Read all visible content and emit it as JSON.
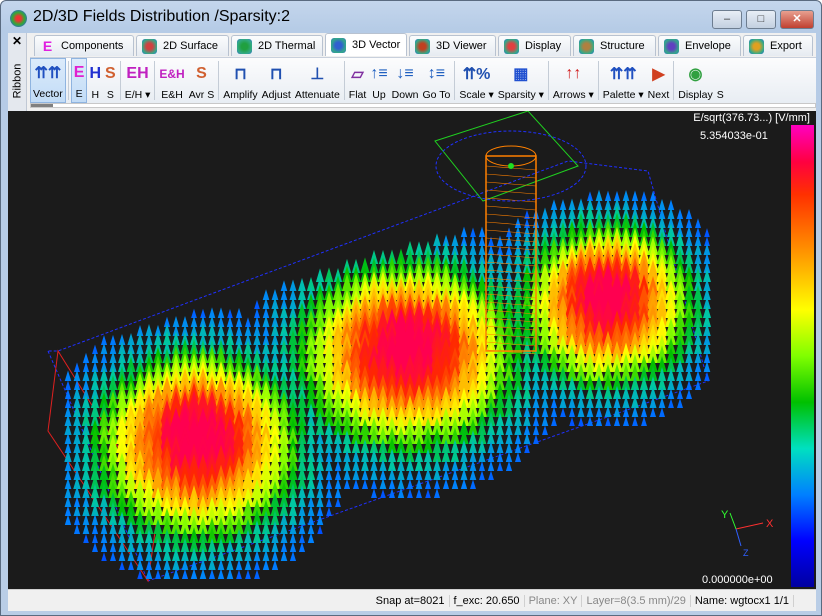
{
  "window": {
    "title": "2D/3D Fields Distribution /Sparsity:2",
    "minimize": "–",
    "maximize": "□",
    "close": "✕"
  },
  "ribbon": {
    "close": "✕",
    "label": "Ribbon"
  },
  "tabs": [
    {
      "label": "Components",
      "icon": "E",
      "color": "#e020e0"
    },
    {
      "label": "2D Surface",
      "icon": "surface-icon",
      "color": "#d04040"
    },
    {
      "label": "2D Thermal",
      "icon": "thermal-icon",
      "color": "#20a040"
    },
    {
      "label": "3D Vector",
      "icon": "vector-icon",
      "color": "#3060d0",
      "active": true
    },
    {
      "label": "3D Viewer",
      "icon": "viewer-icon",
      "color": "#c04020"
    },
    {
      "label": "Display",
      "icon": "display-icon",
      "color": "#e04040"
    },
    {
      "label": "Structure",
      "icon": "structure-icon",
      "color": "#b08040"
    },
    {
      "label": "Envelope",
      "icon": "envelope-icon",
      "color": "#6040c0"
    },
    {
      "label": "Export",
      "icon": "export-icon",
      "color": "#e0a020"
    }
  ],
  "toolbar": [
    {
      "label": "Vector",
      "glyph": "⇈⇈",
      "color": "#2050c0",
      "selected": true
    },
    {
      "sep": true
    },
    {
      "label": "E",
      "glyph": "E",
      "color": "#e020d0",
      "selected": true
    },
    {
      "label": "H",
      "glyph": "H",
      "color": "#2030d0"
    },
    {
      "label": "S",
      "glyph": "S",
      "color": "#d06030"
    },
    {
      "sep": true
    },
    {
      "label": "E/H ▾",
      "glyph": "EH",
      "color": "#c020c0"
    },
    {
      "sep": true
    },
    {
      "label": "E&H",
      "glyph": "E&H",
      "color": "#c020c0"
    },
    {
      "label": "Avr S",
      "glyph": "S",
      "color": "#d06030"
    },
    {
      "sep": true
    },
    {
      "label": "Amplify",
      "glyph": "⊓",
      "color": "#2050b0"
    },
    {
      "label": "Adjust",
      "glyph": "⊓",
      "color": "#2050b0"
    },
    {
      "label": "Attenuate",
      "glyph": "⊥",
      "color": "#2050b0"
    },
    {
      "sep": true
    },
    {
      "label": "Flat",
      "glyph": "▱",
      "color": "#8030a0"
    },
    {
      "label": "Up",
      "glyph": "↑≡",
      "color": "#2060c0"
    },
    {
      "label": "Down",
      "glyph": "↓≡",
      "color": "#2060c0"
    },
    {
      "label": "Go To",
      "glyph": "↕≡",
      "color": "#2060c0"
    },
    {
      "sep": true
    },
    {
      "label": "Scale ▾",
      "glyph": "⇈%",
      "color": "#2050b0"
    },
    {
      "label": "Sparsity ▾",
      "glyph": "▦",
      "color": "#2050d0"
    },
    {
      "sep": true
    },
    {
      "label": "Arrows ▾",
      "glyph": "↑↑",
      "color": "#d02020"
    },
    {
      "sep": true
    },
    {
      "label": "Palette ▾",
      "glyph": "⇈⇈",
      "color": "#2050c0"
    },
    {
      "label": "Next",
      "glyph": "▶",
      "color": "#d04020"
    },
    {
      "sep": true
    },
    {
      "label": "Display",
      "glyph": "◉",
      "color": "#30a040"
    },
    {
      "label": "S",
      "glyph": "",
      "color": "#000"
    }
  ],
  "view": {
    "colorbar_title": "E/sqrt(376.73...) [V/mm]",
    "max": "5.354033e-01",
    "min": "0.000000e+00",
    "axes": {
      "x": "X",
      "y": "Y",
      "z": "Z"
    }
  },
  "status": {
    "snap": "Snap at=8021",
    "fexc": "f_exc: 20.650",
    "plane": "Plane: XY",
    "layer": "Layer=8(3.5 mm)/29",
    "name": "Name: wgtocx1 1/1"
  }
}
